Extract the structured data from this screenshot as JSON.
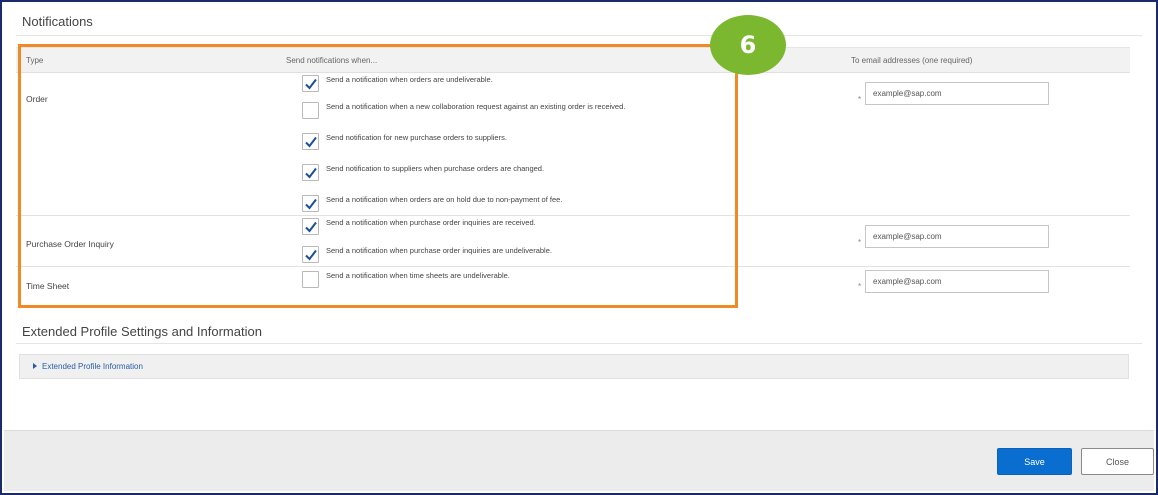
{
  "notifications": {
    "title": "Notifications",
    "columns": {
      "type": "Type",
      "send_when": "Send notifications when...",
      "emails": "To email addresses (one required)"
    },
    "rows": [
      {
        "type": "Order",
        "email": "example@sap.com",
        "options": [
          {
            "label": "Send a notification when orders are undeliverable.",
            "checked": true
          },
          {
            "label": "Send a notification when a new collaboration request against an existing order is received.",
            "checked": false
          },
          {
            "label": "Send notification for new purchase orders to suppliers.",
            "checked": true
          },
          {
            "label": "Send notification to suppliers when purchase orders are changed.",
            "checked": true
          },
          {
            "label": "Send a notification when orders are on hold due to non-payment of fee.",
            "checked": true
          }
        ]
      },
      {
        "type": "Purchase Order Inquiry",
        "email": "example@sap.com",
        "options": [
          {
            "label": "Send a notification when purchase order inquiries are received.",
            "checked": true
          },
          {
            "label": "Send a notification when purchase order inquiries are undeliverable.",
            "checked": true
          }
        ]
      },
      {
        "type": "Time Sheet",
        "email": "example@sap.com",
        "options": [
          {
            "label": "Send a notification when time sheets are undeliverable.",
            "checked": false
          }
        ]
      }
    ],
    "required_marker": "*"
  },
  "step_badge": "6",
  "extended": {
    "title": "Extended Profile Settings and Information",
    "link": "Extended Profile Information"
  },
  "footer": {
    "save_label": "Save",
    "close_label": "Close"
  },
  "colors": {
    "highlight": "#f08a24",
    "badge": "#7cb82f",
    "checkmark": "#1a4f9c",
    "primary_button": "#0a6ed1",
    "link": "#2a5ca8"
  }
}
